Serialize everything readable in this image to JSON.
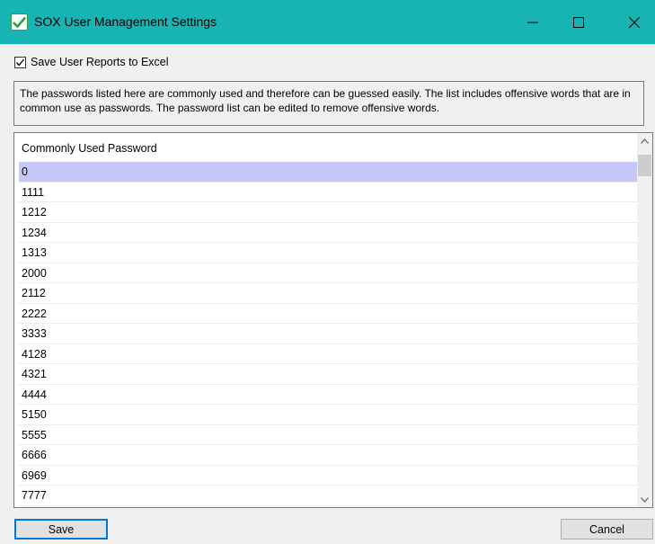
{
  "window": {
    "title": "SOX User Management Settings",
    "icon": "app-check-icon",
    "controls": [
      "minimize-icon",
      "maximize-icon",
      "close-icon"
    ],
    "accent_color": "#18b4b4"
  },
  "options": {
    "save_reports_label": "Save User Reports to Excel",
    "save_reports_checked": true
  },
  "info": {
    "text": "The passwords listed here are commonly used and therefore can be guessed easily. The list includes offensive words that are in common use as passwords. The password list can be edited to remove offensive words."
  },
  "grid": {
    "header": "Commonly Used Password",
    "selected_row_color": "#c6c8fa",
    "rows": [
      "0",
      "1111",
      "1212",
      "1234",
      "1313",
      "2000",
      "2112",
      "2222",
      "3333",
      "4128",
      "4321",
      "4444",
      "5150",
      "5555",
      "6666",
      "6969",
      "7777"
    ]
  },
  "buttons": {
    "save": "Save",
    "cancel": "Cancel"
  }
}
